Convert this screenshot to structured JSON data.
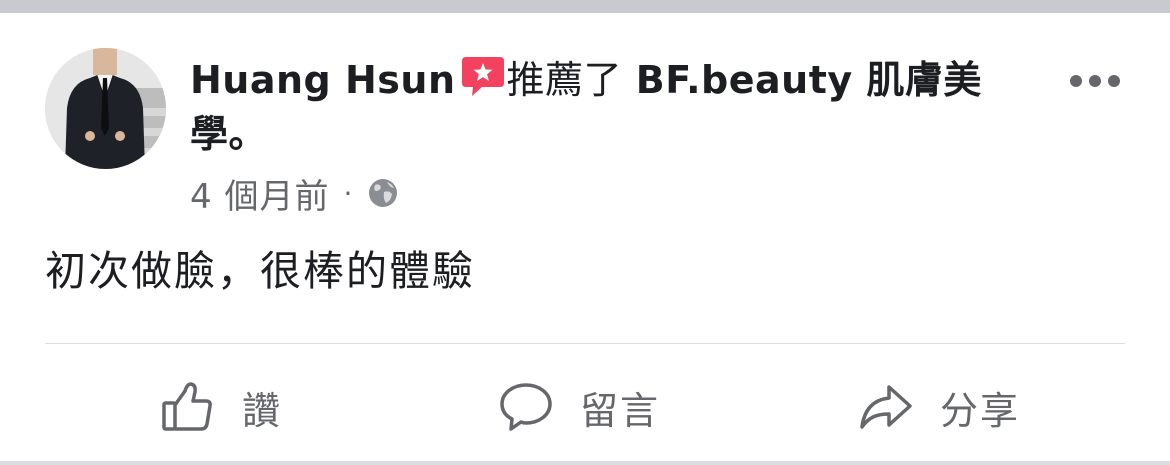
{
  "post": {
    "author_name": "Huang Hsun",
    "action_text": "推薦了",
    "page_name": "BF.beauty 肌膚美學",
    "end_punct": "。",
    "timestamp": "4 個月前",
    "separator": "·",
    "privacy_icon": "globe-icon",
    "body": "初次做臉，很棒的體驗",
    "recommend_icon": "recommend-star-icon",
    "more_icon": "more-horizontal-icon"
  },
  "actions": {
    "like_label": "讚",
    "comment_label": "留言",
    "share_label": "分享",
    "like_icon": "thumbs-up-icon",
    "comment_icon": "comment-bubble-icon",
    "share_icon": "share-arrow-icon"
  },
  "colors": {
    "text_primary": "#1c1e21",
    "text_secondary": "#65676b",
    "recommend_badge": "#f3425f",
    "divider": "#dadde1"
  }
}
